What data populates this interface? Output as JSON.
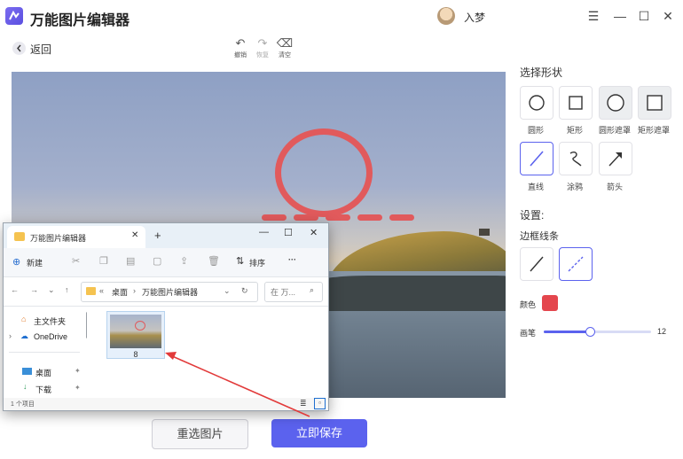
{
  "app": {
    "title": "万能图片编辑器",
    "user": "入梦"
  },
  "toolbar": {
    "back_label": "返回",
    "undo_label": "撤销",
    "redo_label": "恢复",
    "clear_label": "清空"
  },
  "panel": {
    "select_shape_title": "选择形状",
    "shapes": [
      "圆形",
      "矩形",
      "圆形遮罩",
      "矩形遮罩",
      "直线",
      "涂鸦",
      "箭头"
    ],
    "settings_title": "设置:",
    "border_title": "边框线条",
    "color_label": "颜色",
    "brush_label": "画笔",
    "brush_value": "12",
    "brush_fraction": 0.43,
    "accent_color": "#5b62ee",
    "mark_color": "#e4464d"
  },
  "buttons": {
    "reselect": "重选图片",
    "save": "立即保存"
  },
  "explorer": {
    "tab_title": "万能图片编辑器",
    "new_label": "新建",
    "sort_label": "排序",
    "more_label": "···",
    "breadcrumb_sep": "«",
    "crumb_desktop": "桌面",
    "crumb_folder": "万能图片编辑器",
    "search_placeholder": "在 万...",
    "nav": [
      "主文件夹",
      "OneDrive",
      "桌面",
      "下载"
    ],
    "file_name": "8",
    "status": "1 个项目"
  }
}
